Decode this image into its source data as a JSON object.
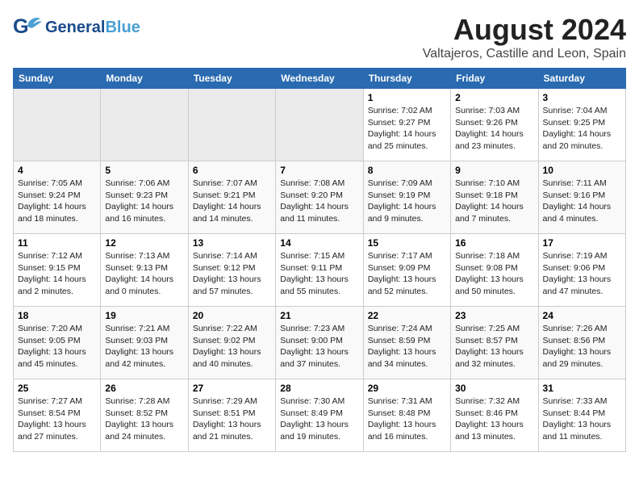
{
  "header": {
    "logo_line1": "General",
    "logo_line2": "Blue",
    "main_title": "August 2024",
    "subtitle": "Valtajeros, Castille and Leon, Spain"
  },
  "days_of_week": [
    "Sunday",
    "Monday",
    "Tuesday",
    "Wednesday",
    "Thursday",
    "Friday",
    "Saturday"
  ],
  "weeks": [
    [
      {
        "day": "",
        "info": ""
      },
      {
        "day": "",
        "info": ""
      },
      {
        "day": "",
        "info": ""
      },
      {
        "day": "",
        "info": ""
      },
      {
        "day": "1",
        "info": "Sunrise: 7:02 AM\nSunset: 9:27 PM\nDaylight: 14 hours\nand 25 minutes."
      },
      {
        "day": "2",
        "info": "Sunrise: 7:03 AM\nSunset: 9:26 PM\nDaylight: 14 hours\nand 23 minutes."
      },
      {
        "day": "3",
        "info": "Sunrise: 7:04 AM\nSunset: 9:25 PM\nDaylight: 14 hours\nand 20 minutes."
      }
    ],
    [
      {
        "day": "4",
        "info": "Sunrise: 7:05 AM\nSunset: 9:24 PM\nDaylight: 14 hours\nand 18 minutes."
      },
      {
        "day": "5",
        "info": "Sunrise: 7:06 AM\nSunset: 9:23 PM\nDaylight: 14 hours\nand 16 minutes."
      },
      {
        "day": "6",
        "info": "Sunrise: 7:07 AM\nSunset: 9:21 PM\nDaylight: 14 hours\nand 14 minutes."
      },
      {
        "day": "7",
        "info": "Sunrise: 7:08 AM\nSunset: 9:20 PM\nDaylight: 14 hours\nand 11 minutes."
      },
      {
        "day": "8",
        "info": "Sunrise: 7:09 AM\nSunset: 9:19 PM\nDaylight: 14 hours\nand 9 minutes."
      },
      {
        "day": "9",
        "info": "Sunrise: 7:10 AM\nSunset: 9:18 PM\nDaylight: 14 hours\nand 7 minutes."
      },
      {
        "day": "10",
        "info": "Sunrise: 7:11 AM\nSunset: 9:16 PM\nDaylight: 14 hours\nand 4 minutes."
      }
    ],
    [
      {
        "day": "11",
        "info": "Sunrise: 7:12 AM\nSunset: 9:15 PM\nDaylight: 14 hours\nand 2 minutes."
      },
      {
        "day": "12",
        "info": "Sunrise: 7:13 AM\nSunset: 9:13 PM\nDaylight: 14 hours\nand 0 minutes."
      },
      {
        "day": "13",
        "info": "Sunrise: 7:14 AM\nSunset: 9:12 PM\nDaylight: 13 hours\nand 57 minutes."
      },
      {
        "day": "14",
        "info": "Sunrise: 7:15 AM\nSunset: 9:11 PM\nDaylight: 13 hours\nand 55 minutes."
      },
      {
        "day": "15",
        "info": "Sunrise: 7:17 AM\nSunset: 9:09 PM\nDaylight: 13 hours\nand 52 minutes."
      },
      {
        "day": "16",
        "info": "Sunrise: 7:18 AM\nSunset: 9:08 PM\nDaylight: 13 hours\nand 50 minutes."
      },
      {
        "day": "17",
        "info": "Sunrise: 7:19 AM\nSunset: 9:06 PM\nDaylight: 13 hours\nand 47 minutes."
      }
    ],
    [
      {
        "day": "18",
        "info": "Sunrise: 7:20 AM\nSunset: 9:05 PM\nDaylight: 13 hours\nand 45 minutes."
      },
      {
        "day": "19",
        "info": "Sunrise: 7:21 AM\nSunset: 9:03 PM\nDaylight: 13 hours\nand 42 minutes."
      },
      {
        "day": "20",
        "info": "Sunrise: 7:22 AM\nSunset: 9:02 PM\nDaylight: 13 hours\nand 40 minutes."
      },
      {
        "day": "21",
        "info": "Sunrise: 7:23 AM\nSunset: 9:00 PM\nDaylight: 13 hours\nand 37 minutes."
      },
      {
        "day": "22",
        "info": "Sunrise: 7:24 AM\nSunset: 8:59 PM\nDaylight: 13 hours\nand 34 minutes."
      },
      {
        "day": "23",
        "info": "Sunrise: 7:25 AM\nSunset: 8:57 PM\nDaylight: 13 hours\nand 32 minutes."
      },
      {
        "day": "24",
        "info": "Sunrise: 7:26 AM\nSunset: 8:56 PM\nDaylight: 13 hours\nand 29 minutes."
      }
    ],
    [
      {
        "day": "25",
        "info": "Sunrise: 7:27 AM\nSunset: 8:54 PM\nDaylight: 13 hours\nand 27 minutes."
      },
      {
        "day": "26",
        "info": "Sunrise: 7:28 AM\nSunset: 8:52 PM\nDaylight: 13 hours\nand 24 minutes."
      },
      {
        "day": "27",
        "info": "Sunrise: 7:29 AM\nSunset: 8:51 PM\nDaylight: 13 hours\nand 21 minutes."
      },
      {
        "day": "28",
        "info": "Sunrise: 7:30 AM\nSunset: 8:49 PM\nDaylight: 13 hours\nand 19 minutes."
      },
      {
        "day": "29",
        "info": "Sunrise: 7:31 AM\nSunset: 8:48 PM\nDaylight: 13 hours\nand 16 minutes."
      },
      {
        "day": "30",
        "info": "Sunrise: 7:32 AM\nSunset: 8:46 PM\nDaylight: 13 hours\nand 13 minutes."
      },
      {
        "day": "31",
        "info": "Sunrise: 7:33 AM\nSunset: 8:44 PM\nDaylight: 13 hours\nand 11 minutes."
      }
    ]
  ]
}
